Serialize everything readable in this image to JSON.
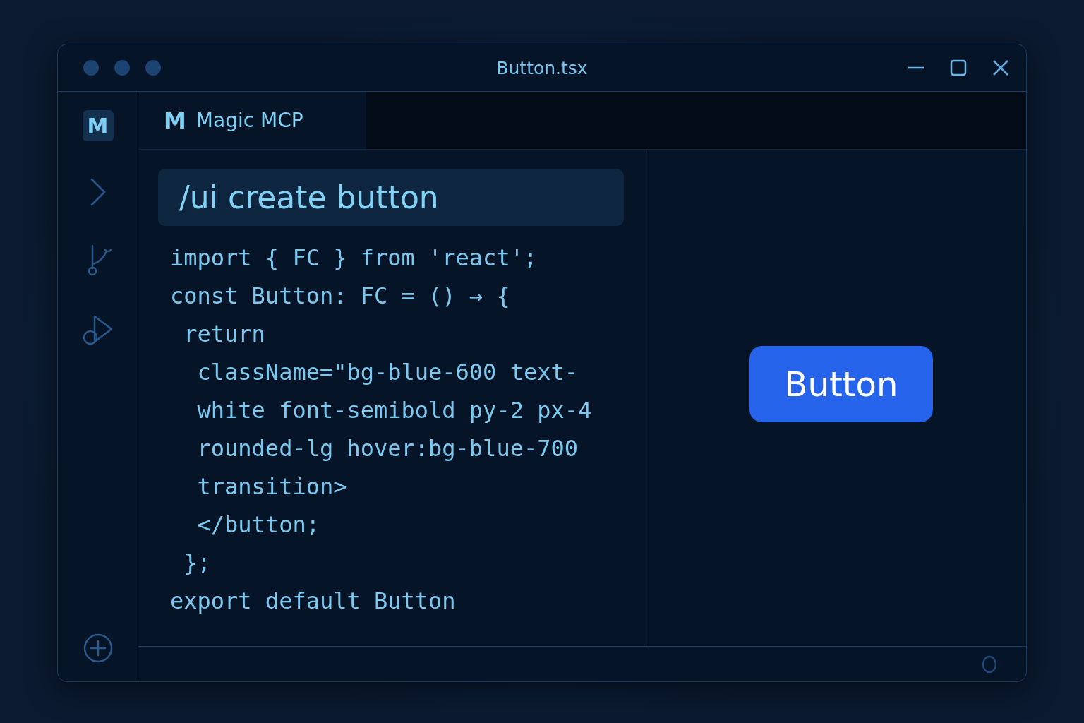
{
  "window": {
    "title": "Button.tsx"
  },
  "activity_bar": {
    "logo": "M"
  },
  "tabs": [
    {
      "logo": "M",
      "label": "Magic MCP",
      "selected": true
    }
  ],
  "editor": {
    "prompt": "/ui create button",
    "code_lines": [
      "import { FC } from 'react';",
      "const Button: FC = () → {",
      " return",
      "  className=\"bg-blue-600 text-",
      "  white font-semibold py-2 px-4",
      "  rounded-lg hover:bg-blue-700",
      "  transition>",
      "  </button;",
      " };",
      "export default Button"
    ]
  },
  "preview": {
    "button_label": "Button"
  }
}
